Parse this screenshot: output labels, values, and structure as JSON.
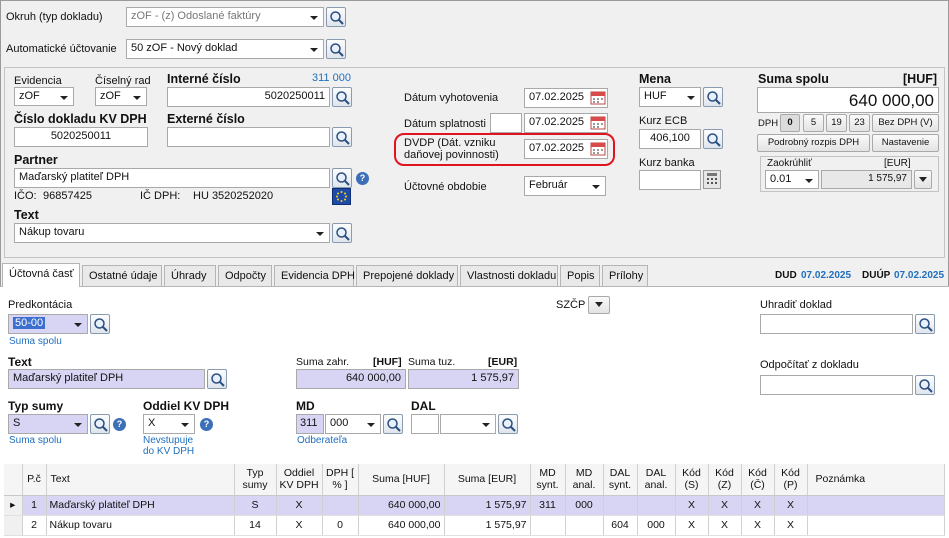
{
  "header": {
    "okruh_label": "Okruh (typ dokladu)",
    "okruh_value": "zOF - (z) Odoslané faktúry",
    "auto_label": "Automatické účtovanie",
    "auto_value": "50 zOF - Nový doklad"
  },
  "doc": {
    "evidencia_label": "Evidencia",
    "evidencia_value": "zOF",
    "ciselny_label": "Číselný rad",
    "ciselny_value": "zOF",
    "interne_label": "Interné číslo",
    "interne_counter": "311  000",
    "interne_value": "5020250011",
    "kvdph_label": "Číslo dokladu KV DPH",
    "kvdph_value": "5020250011",
    "externe_label": "Externé číslo",
    "externe_value": "",
    "partner_label": "Partner",
    "partner_value": "Maďarský platiteľ DPH",
    "ico_label": "IČO:",
    "ico_value": "96857425",
    "icdph_label": "IČ DPH:",
    "icdph_value": "HU 3520252020",
    "text_label": "Text",
    "text_value": "Nákup tovaru"
  },
  "dates": {
    "vyhotovenia_label": "Dátum vyhotovenia",
    "vyhotovenia_value": "07.02.2025",
    "splatnosti_label": "Dátum splatnosti",
    "splatnosti_value": "07.02.2025",
    "dvdp_label": "DVDP (Dát. vzniku daňovej povinnosti)",
    "dvdp_value": "07.02.2025",
    "obdobie_label": "Účtovné obdobie",
    "obdobie_value": "Február"
  },
  "currency": {
    "mena_label": "Mena",
    "mena_value": "HUF",
    "kurz_ecb_label": "Kurz ECB",
    "kurz_ecb_value": "406,100",
    "kurz_banka_label": "Kurz banka",
    "kurz_banka_value": ""
  },
  "sum": {
    "title": "Suma spolu",
    "unit": "[HUF]",
    "value": "640 000,00",
    "dph_label": "DPH",
    "rates": [
      "0",
      "5",
      "19",
      "23"
    ],
    "bez_dph": "Bez DPH (V)",
    "rozpis": "Podrobný rozpis DPH",
    "nastavenie": "Nastavenie",
    "zaokruhlit_label": "Zaokrúhliť",
    "zaokruhlit_unit": "[EUR]",
    "zaokruhlit_value": "0.01",
    "zaokruhlit_eur": "1 575,97"
  },
  "tabs": [
    "Účtovná časť",
    "Ostatné údaje",
    "Úhrady",
    "Odpočty",
    "Evidencia DPH",
    "Prepojené doklady",
    "Vlastnosti dokladu",
    "Popis",
    "Prílohy"
  ],
  "dud": {
    "dud_label": "DUD",
    "dud_value": "07.02.2025",
    "duup_label": "DUÚP",
    "duup_value": "07.02.2025"
  },
  "form": {
    "predkontacia_label": "Predkontácia",
    "predkontacia_value": "50-00",
    "suma_spolu_link": "Suma spolu",
    "szcp_label": "SZČP",
    "uhradit_label": "Uhradiť doklad",
    "odpocitat_label": "Odpočítať z dokladu",
    "text_label": "Text",
    "text_value": "Maďarský platiteľ DPH",
    "suma_zahr_label": "Suma zahr.",
    "suma_zahr_unit": "[HUF]",
    "suma_zahr_value": "640 000,00",
    "suma_tuz_label": "Suma tuz.",
    "suma_tuz_unit": "[EUR]",
    "suma_tuz_value": "1 575,97",
    "typ_sumy_label": "Typ sumy",
    "typ_sumy_value": "S",
    "typ_sumy_link": "Suma spolu",
    "oddiel_label": "Oddiel KV DPH",
    "oddiel_value": "X",
    "oddiel_link1": "Nevstupuje",
    "oddiel_link2": "do KV DPH",
    "md_label": "MD",
    "md_synt": "311",
    "md_anal": "000",
    "md_link": "Odberateľa",
    "dal_label": "DAL"
  },
  "grid": {
    "headers": [
      "P.č",
      "Text",
      "Typ sumy",
      "Oddiel KV DPH",
      "DPH [ % ]",
      "Suma [HUF]",
      "Suma [EUR]",
      "MD synt.",
      "MD anal.",
      "DAL synt.",
      "DAL anal.",
      "Kód (S)",
      "Kód (Z)",
      "Kód (Č)",
      "Kód (P)",
      "Poznámka"
    ],
    "rows": [
      [
        "1",
        "Maďarský platiteľ DPH",
        "S",
        "X",
        "",
        "640 000,00",
        "1 575,97",
        "311",
        "000",
        "",
        "",
        "X",
        "X",
        "X",
        "X",
        ""
      ],
      [
        "2",
        "Nákup tovaru",
        "14",
        "X",
        "0",
        "640 000,00",
        "1 575,97",
        "",
        "",
        "604",
        "000",
        "X",
        "X",
        "X",
        "X",
        ""
      ]
    ]
  },
  "colors": {
    "highlight": "#d8d4f4",
    "accent_blue": "#1f6fbf",
    "annotation_red": "#e0141e"
  }
}
